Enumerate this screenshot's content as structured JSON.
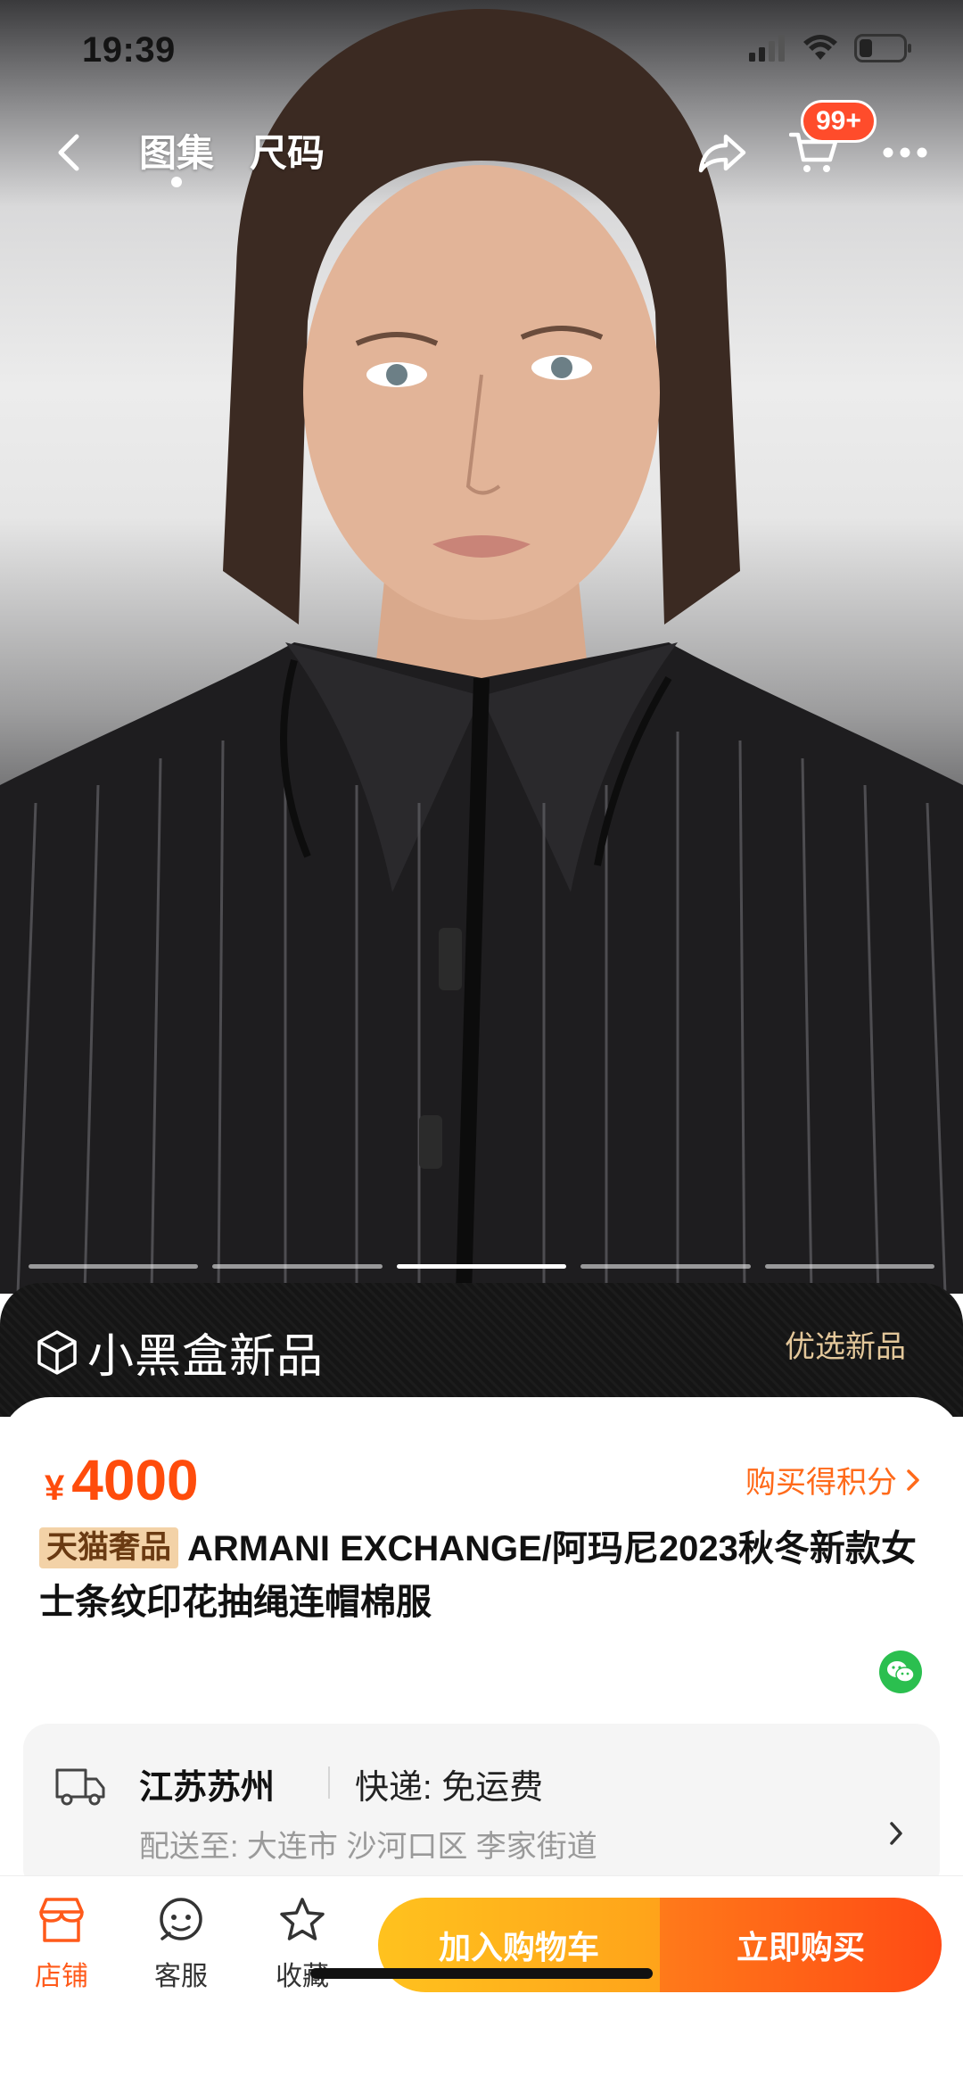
{
  "status_bar": {
    "time": "19:39"
  },
  "nav": {
    "tabs": [
      {
        "label": "图集",
        "active": true
      },
      {
        "label": "尺码",
        "active": false
      }
    ],
    "cart_badge": "99+"
  },
  "gallery": {
    "slides": 5,
    "active_index": 2
  },
  "promo": {
    "logo_text": "小黑盒新品",
    "right_text": "优选新品"
  },
  "product": {
    "currency": "¥",
    "price": "4000",
    "points_link": "购买得积分",
    "tag": "天猫奢品",
    "title": "ARMANI EXCHANGE/阿玛尼2023秋冬新款女士条纹印花抽绳连帽棉服"
  },
  "shipping": {
    "origin": "江苏苏州",
    "method": "快递: 免运费",
    "destination": "配送至: 大连市 沙河口区 李家街道"
  },
  "bottom_bar": {
    "items": [
      {
        "label": "店铺",
        "icon": "store-icon"
      },
      {
        "label": "客服",
        "icon": "service-icon"
      },
      {
        "label": "收藏",
        "icon": "star-icon"
      }
    ],
    "add_to_cart": "加入购物车",
    "buy_now": "立即购买"
  },
  "colors": {
    "accent_orange": "#ff4c0c",
    "cart_button": "#ffa31a",
    "buy_button": "#ff4a14",
    "promo_gold": "#e3c79a"
  }
}
